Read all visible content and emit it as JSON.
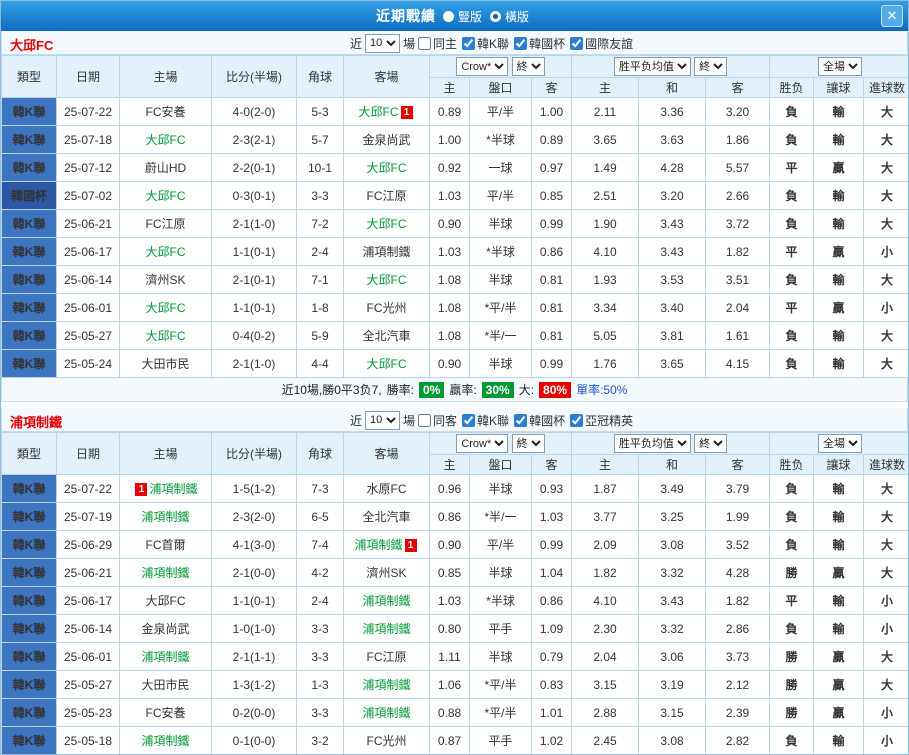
{
  "titlebar": {
    "title": "近期戰績",
    "vertical_label": "豎版",
    "horizontal_label": "橫版",
    "selected": "橫版",
    "close_glyph": "✕"
  },
  "colors": {
    "red": "#E60000",
    "green": "#009933",
    "blue": "#2653C9",
    "gray": "#808080",
    "league_k": "#3C74C0",
    "league_cup": "#2C58A6"
  },
  "sections": [
    {
      "team": "大邱FC",
      "filter": {
        "near_label": "近",
        "count": "10",
        "games_label": "場",
        "checks": [
          {
            "label": "同主",
            "checked": false
          },
          {
            "label": "韓K聯",
            "checked": true
          },
          {
            "label": "韓國杯",
            "checked": true
          },
          {
            "label": "國際友誼",
            "checked": true
          }
        ]
      },
      "header": {
        "cols": [
          "類型",
          "日期",
          "主場",
          "比分(半場)",
          "角球",
          "客場"
        ],
        "odds_company": "Crow*",
        "final_label": "終",
        "eu_label": "胜平负均值",
        "scope_label": "全場",
        "sub": [
          "主",
          "盤口",
          "客",
          "主",
          "和",
          "客",
          "胜负",
          "讓球",
          "進球数"
        ]
      },
      "rows": [
        {
          "league": "韓K聯",
          "date": "25-07-22",
          "home": "FC安養",
          "homeTeam": false,
          "score": "4-0(2-0)",
          "corner": "5-3",
          "away": "大邱FC",
          "awayTeam": true,
          "awayBadge": "1",
          "o1": "0.89",
          "hcap": "平/半",
          "o2": "1.00",
          "e1": "2.11",
          "e2": "3.36",
          "e3": "3.20",
          "res": "負",
          "hres": "輸",
          "goals": "大"
        },
        {
          "league": "韓K聯",
          "date": "25-07-18",
          "home": "大邱FC",
          "homeTeam": true,
          "score": "2-3(2-1)",
          "corner": "5-7",
          "away": "金泉尚武",
          "awayTeam": false,
          "o1": "1.00",
          "hcap": "*半球",
          "o2": "0.89",
          "e1": "3.65",
          "e2": "3.63",
          "e3": "1.86",
          "res": "負",
          "hres": "輸",
          "goals": "大"
        },
        {
          "league": "韓K聯",
          "date": "25-07-12",
          "home": "蔚山HD",
          "homeTeam": false,
          "score": "2-2(0-1)",
          "corner": "10-1",
          "away": "大邱FC",
          "awayTeam": true,
          "o1": "0.92",
          "hcap": "一球",
          "o2": "0.97",
          "e1": "1.49",
          "e2": "4.28",
          "e3": "5.57",
          "res": "平",
          "hres": "贏",
          "goals": "大"
        },
        {
          "league": "韓國杯",
          "date": "25-07-02",
          "home": "大邱FC",
          "homeTeam": true,
          "score": "0-3(0-1)",
          "corner": "3-3",
          "away": "FC江原",
          "awayTeam": false,
          "o1": "1.03",
          "hcap": "平/半",
          "o2": "0.85",
          "e1": "2.51",
          "e2": "3.20",
          "e3": "2.66",
          "res": "負",
          "hres": "輸",
          "goals": "大"
        },
        {
          "league": "韓K聯",
          "date": "25-06-21",
          "home": "FC江原",
          "homeTeam": false,
          "score": "2-1(1-0)",
          "corner": "7-2",
          "away": "大邱FC",
          "awayTeam": true,
          "o1": "0.90",
          "hcap": "半球",
          "o2": "0.99",
          "e1": "1.90",
          "e2": "3.43",
          "e3": "3.72",
          "res": "負",
          "hres": "輸",
          "goals": "大"
        },
        {
          "league": "韓K聯",
          "date": "25-06-17",
          "home": "大邱FC",
          "homeTeam": true,
          "score": "1-1(0-1)",
          "corner": "2-4",
          "away": "浦項制鐵",
          "awayTeam": false,
          "o1": "1.03",
          "hcap": "*半球",
          "o2": "0.86",
          "e1": "4.10",
          "e2": "3.43",
          "e3": "1.82",
          "res": "平",
          "hres": "贏",
          "goals": "小"
        },
        {
          "league": "韓K聯",
          "date": "25-06-14",
          "home": "濟州SK",
          "homeTeam": false,
          "score": "2-1(0-1)",
          "corner": "7-1",
          "away": "大邱FC",
          "awayTeam": true,
          "o1": "1.08",
          "hcap": "半球",
          "o2": "0.81",
          "e1": "1.93",
          "e2": "3.53",
          "e3": "3.51",
          "res": "負",
          "hres": "輸",
          "goals": "大"
        },
        {
          "league": "韓K聯",
          "date": "25-06-01",
          "home": "大邱FC",
          "homeTeam": true,
          "score": "1-1(0-1)",
          "corner": "1-8",
          "away": "FC光州",
          "awayTeam": false,
          "o1": "1.08",
          "hcap": "*平/半",
          "o2": "0.81",
          "e1": "3.34",
          "e2": "3.40",
          "e3": "2.04",
          "res": "平",
          "hres": "贏",
          "goals": "小"
        },
        {
          "league": "韓K聯",
          "date": "25-05-27",
          "home": "大邱FC",
          "homeTeam": true,
          "score": "0-4(0-2)",
          "corner": "5-9",
          "away": "全北汽車",
          "awayTeam": false,
          "o1": "1.08",
          "hcap": "*半/一",
          "o2": "0.81",
          "e1": "5.05",
          "e2": "3.81",
          "e3": "1.61",
          "res": "負",
          "hres": "輸",
          "goals": "大"
        },
        {
          "league": "韓K聯",
          "date": "25-05-24",
          "home": "大田市民",
          "homeTeam": false,
          "score": "2-1(1-0)",
          "corner": "4-4",
          "away": "大邱FC",
          "awayTeam": true,
          "o1": "0.90",
          "hcap": "半球",
          "o2": "0.99",
          "e1": "1.76",
          "e2": "3.65",
          "e3": "4.15",
          "res": "負",
          "hres": "輸",
          "goals": "大"
        }
      ],
      "summary": {
        "prefix": "近10場,勝0平3负7,",
        "win_label": "勝率:",
        "win_value": "0%",
        "cover_label": "贏率:",
        "cover_value": "30%",
        "big_label": "大:",
        "big_value": "80%",
        "odd_text": "單率:50%"
      }
    },
    {
      "team": "浦項制鐵",
      "filter": {
        "near_label": "近",
        "count": "10",
        "games_label": "場",
        "checks": [
          {
            "label": "同客",
            "checked": false
          },
          {
            "label": "韓K聯",
            "checked": true
          },
          {
            "label": "韓國杯",
            "checked": true
          },
          {
            "label": "亞冠精英",
            "checked": true
          }
        ]
      },
      "header": {
        "cols": [
          "類型",
          "日期",
          "主場",
          "比分(半場)",
          "角球",
          "客場"
        ],
        "odds_company": "Crow*",
        "final_label": "終",
        "eu_label": "胜平负均值",
        "scope_label": "全場",
        "sub": [
          "主",
          "盤口",
          "客",
          "主",
          "和",
          "客",
          "胜负",
          "讓球",
          "進球数"
        ]
      },
      "rows": [
        {
          "league": "韓K聯",
          "date": "25-07-22",
          "home": "浦項制鐵",
          "homeTeam": true,
          "homeBadge": "1",
          "homeBadgeBefore": true,
          "score": "1-5(1-2)",
          "corner": "7-3",
          "away": "水原FC",
          "awayTeam": false,
          "o1": "0.96",
          "hcap": "半球",
          "o2": "0.93",
          "e1": "1.87",
          "e2": "3.49",
          "e3": "3.79",
          "res": "負",
          "hres": "輸",
          "goals": "大"
        },
        {
          "league": "韓K聯",
          "date": "25-07-19",
          "home": "浦項制鐵",
          "homeTeam": true,
          "score": "2-3(2-0)",
          "corner": "6-5",
          "away": "全北汽車",
          "awayTeam": false,
          "o1": "0.86",
          "hcap": "*半/一",
          "o2": "1.03",
          "e1": "3.77",
          "e2": "3.25",
          "e3": "1.99",
          "res": "負",
          "hres": "輸",
          "goals": "大"
        },
        {
          "league": "韓K聯",
          "date": "25-06-29",
          "home": "FC首爾",
          "homeTeam": false,
          "score": "4-1(3-0)",
          "corner": "7-4",
          "away": "浦項制鐵",
          "awayTeam": true,
          "awayBadge": "1",
          "o1": "0.90",
          "hcap": "平/半",
          "o2": "0.99",
          "e1": "2.09",
          "e2": "3.08",
          "e3": "3.52",
          "res": "負",
          "hres": "輸",
          "goals": "大"
        },
        {
          "league": "韓K聯",
          "date": "25-06-21",
          "home": "浦項制鐵",
          "homeTeam": true,
          "score": "2-1(0-0)",
          "corner": "4-2",
          "away": "濟州SK",
          "awayTeam": false,
          "o1": "0.85",
          "hcap": "半球",
          "o2": "1.04",
          "e1": "1.82",
          "e2": "3.32",
          "e3": "4.28",
          "res": "勝",
          "hres": "贏",
          "goals": "大"
        },
        {
          "league": "韓K聯",
          "date": "25-06-17",
          "home": "大邱FC",
          "homeTeam": false,
          "score": "1-1(0-1)",
          "corner": "2-4",
          "away": "浦項制鐵",
          "awayTeam": true,
          "o1": "1.03",
          "hcap": "*半球",
          "o2": "0.86",
          "e1": "4.10",
          "e2": "3.43",
          "e3": "1.82",
          "res": "平",
          "hres": "輸",
          "goals": "小"
        },
        {
          "league": "韓K聯",
          "date": "25-06-14",
          "home": "金泉尚武",
          "homeTeam": false,
          "score": "1-0(1-0)",
          "corner": "3-3",
          "away": "浦項制鐵",
          "awayTeam": true,
          "o1": "0.80",
          "hcap": "平手",
          "o2": "1.09",
          "e1": "2.30",
          "e2": "3.32",
          "e3": "2.86",
          "res": "負",
          "hres": "輸",
          "goals": "小"
        },
        {
          "league": "韓K聯",
          "date": "25-06-01",
          "home": "浦項制鐵",
          "homeTeam": true,
          "score": "2-1(1-1)",
          "corner": "3-3",
          "away": "FC江原",
          "awayTeam": false,
          "o1": "1.11",
          "hcap": "半球",
          "o2": "0.79",
          "e1": "2.04",
          "e2": "3.06",
          "e3": "3.73",
          "res": "勝",
          "hres": "贏",
          "goals": "大"
        },
        {
          "league": "韓K聯",
          "date": "25-05-27",
          "home": "大田市民",
          "homeTeam": false,
          "score": "1-3(1-2)",
          "corner": "1-3",
          "away": "浦項制鐵",
          "awayTeam": true,
          "o1": "1.06",
          "hcap": "*平/半",
          "o2": "0.83",
          "e1": "3.15",
          "e2": "3.19",
          "e3": "2.12",
          "res": "勝",
          "hres": "贏",
          "goals": "大"
        },
        {
          "league": "韓K聯",
          "date": "25-05-23",
          "home": "FC安養",
          "homeTeam": false,
          "score": "0-2(0-0)",
          "corner": "3-3",
          "away": "浦項制鐵",
          "awayTeam": true,
          "o1": "0.88",
          "hcap": "*平/半",
          "o2": "1.01",
          "e1": "2.88",
          "e2": "3.15",
          "e3": "2.39",
          "res": "勝",
          "hres": "贏",
          "goals": "小"
        },
        {
          "league": "韓K聯",
          "date": "25-05-18",
          "home": "浦項制鐵",
          "homeTeam": true,
          "score": "0-1(0-0)",
          "corner": "3-2",
          "away": "FC光州",
          "awayTeam": false,
          "o1": "0.87",
          "hcap": "平手",
          "o2": "1.02",
          "e1": "2.45",
          "e2": "3.08",
          "e3": "2.82",
          "res": "負",
          "hres": "輸",
          "goals": "小"
        }
      ]
    }
  ]
}
